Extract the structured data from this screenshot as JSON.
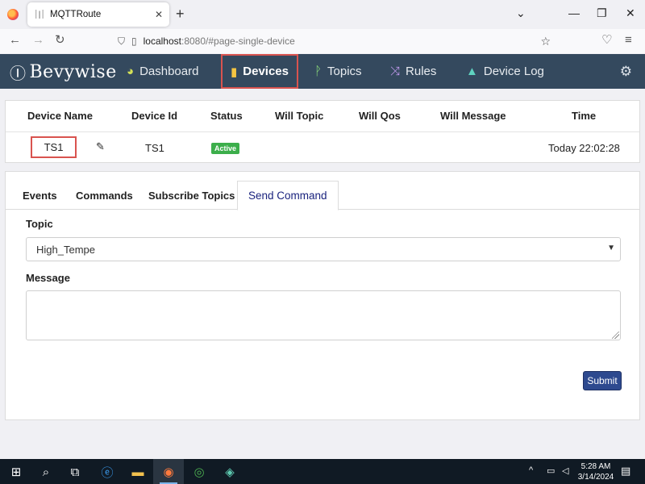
{
  "browser": {
    "tab_title": "MQTTRoute",
    "url_host": "localhost",
    "url_rest": ":8080/#page-single-device"
  },
  "app": {
    "brand": "Bevywise",
    "nav": [
      {
        "label": "Dashboard",
        "icon": "dashboard-icon"
      },
      {
        "label": "Devices",
        "icon": "devices-icon",
        "active": true
      },
      {
        "label": "Topics",
        "icon": "topics-icon"
      },
      {
        "label": "Rules",
        "icon": "rules-icon"
      },
      {
        "label": "Device Log",
        "icon": "warning-icon"
      }
    ],
    "accent_color": "#34495e"
  },
  "device_table": {
    "headers": [
      "Device Name",
      "Device Id",
      "Status",
      "Will Topic",
      "Will Qos",
      "Will Message",
      "Time"
    ],
    "row": {
      "device_name": "TS1",
      "device_id": "TS1",
      "status": "Active",
      "will_topic": "",
      "will_qos": "",
      "will_message": "",
      "time": "Today 22:02:28"
    }
  },
  "tabs": [
    "Events",
    "Commands",
    "Subscribe Topics",
    "Send Command"
  ],
  "form": {
    "topic_label": "Topic",
    "topic_value": "High_Tempe",
    "message_label": "Message",
    "message_value": "",
    "submit_label": "Submit"
  },
  "taskbar": {
    "time": "5:28 AM",
    "date": "3/14/2024"
  }
}
